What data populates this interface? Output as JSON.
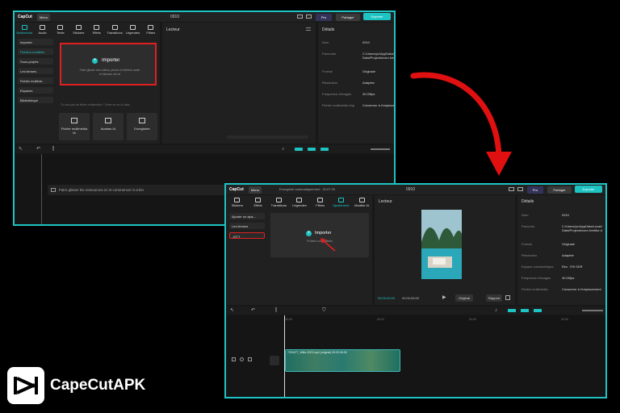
{
  "colors": {
    "accent": "#1ec3c3",
    "highlight": "#e02020",
    "arrow": "#e01010"
  },
  "win1": {
    "logo": "CapCut",
    "menu": "Menu",
    "project_title": "0910",
    "pro": "Pro",
    "share": "Partager",
    "export": "Exporter",
    "tabs": [
      "Multimédia",
      "Audio",
      "Texte",
      "Stickers",
      "Effets",
      "Transitions",
      "Légendes",
      "Filtres"
    ],
    "sidebar": [
      "Importer",
      "Fichiers modèles",
      "Sous-projets",
      "Les liennes",
      "Fichier multimé...",
      "Espaces",
      "Bibliothèque"
    ],
    "import_title": "Importer",
    "import_hint1": "Faire glisser des vidéos, photos et fichiers audio",
    "import_hint2": "et déposer-vis ici",
    "hint_line": "Tu n'as pas de fichier multimédia ? Créer-en un à l'aide...",
    "cards": [
      "Fichier multimédia IA",
      "Avatars IA",
      "Enregistrer"
    ],
    "player_title": "Lecteur",
    "details_title": "Détails",
    "details": [
      {
        "k": "Nom",
        "v": "0910"
      },
      {
        "k": "Parcoutrs",
        "v": "C:/Users/pc/AppData/Local/CapCut/User Data/Projects/com.lveditor.draft/0910"
      },
      {
        "k": "Format",
        "v": "Originale"
      },
      {
        "k": "Résolution",
        "v": "Adaptée"
      },
      {
        "k": "Fréquence d'images",
        "v": "30.00fps"
      },
      {
        "k": "Fichier multimédia importé",
        "v": "Conserver à l'emplacement d'origine"
      }
    ],
    "timeline_hint": "Faire glisser les ressources ici et commencer à créer"
  },
  "win2": {
    "logo": "CapCut",
    "menu": "Menu",
    "autosave": "Enregistré automatiquement : 22:07:20",
    "project_title": "0910",
    "pro": "Pro",
    "share": "Partager",
    "export": "Exporter",
    "tabs": [
      "Stickers",
      "Effets",
      "Transitions",
      "Légendes",
      "Filtres",
      "Ajustement",
      "Modèle IA"
    ],
    "sidebar": [
      "Ajouter un ajus...",
      "Les liennes",
      "JSTT"
    ],
    "import_title": "Importer",
    "import_hint": "Fichiers compatibles",
    "player_title": "Lecteur",
    "time_current": "00:00:00:00",
    "time_total": "00:00:06:00",
    "ratio_label": "Original",
    "quality": "Rapport",
    "details_title": "Détails",
    "details": [
      {
        "k": "Nom",
        "v": "0910"
      },
      {
        "k": "Parcours",
        "v": "C:/Users/pc/AppData/Local/CapCut/User Data/Projects/com.lveditor.draft/0910"
      },
      {
        "k": "Format",
        "v": "Originale"
      },
      {
        "k": "Résolution",
        "v": "Adaptée"
      },
      {
        "k": "Espace colorimétrique",
        "v": "Rec. 709 SDR"
      },
      {
        "k": "Fréquence d'images",
        "v": "30.00fps"
      },
      {
        "k": "Fichier multimédia",
        "v": "Conserver à l'emplacement"
      }
    ],
    "ruler": [
      "00:00",
      "00:10",
      "00:20",
      "00:30"
    ],
    "clip_label": "7294477_Willa 2023.mp4 (original)   00:00:06:00"
  },
  "brand": {
    "name": "CapeCutAPK",
    "icon": "capcut-logo-icon"
  }
}
